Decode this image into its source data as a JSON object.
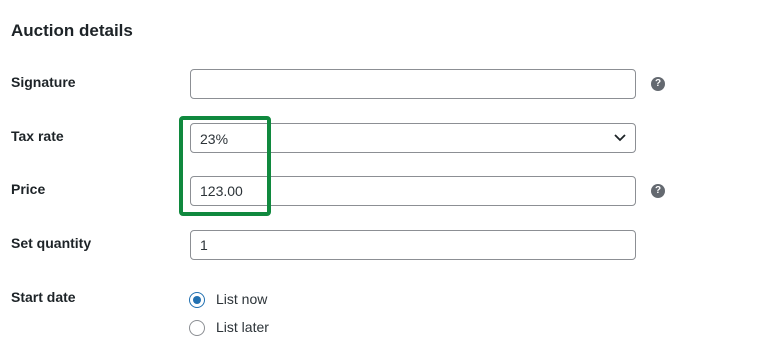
{
  "section": {
    "title": "Auction details"
  },
  "fields": {
    "signature": {
      "label": "Signature",
      "value": ""
    },
    "tax_rate": {
      "label": "Tax rate",
      "value": "23%"
    },
    "price": {
      "label": "Price",
      "value": "123.00"
    },
    "quantity": {
      "label": "Set quantity",
      "value": "1"
    },
    "start_date": {
      "label": "Start date",
      "options": [
        {
          "label": "List now",
          "selected": true
        },
        {
          "label": "List later",
          "selected": false
        }
      ]
    }
  },
  "icons": {
    "help": "question-mark-icon",
    "select": "chevron-down-icon"
  },
  "colors": {
    "highlight": "#10893e",
    "radio_accent": "#2271b1",
    "help_icon": "#646970"
  }
}
